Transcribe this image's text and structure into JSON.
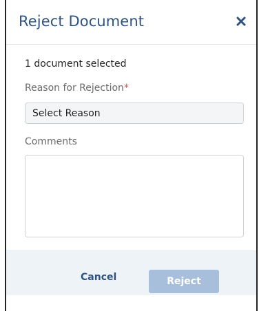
{
  "dialog": {
    "title": "Reject Document",
    "close_icon": "close-icon"
  },
  "body": {
    "selected_count": "1 document selected",
    "reason_label": "Reason for Rejection",
    "required_marker": "*",
    "reason_select_value": "Select Reason",
    "comments_label": "Comments",
    "comments_value": ""
  },
  "footer": {
    "cancel_label": "Cancel",
    "reject_label": "Reject",
    "reject_disabled": true
  },
  "colors": {
    "title": "#2e5381",
    "required": "#d9534f",
    "footer_bg": "#eef3f8",
    "reject_disabled_bg": "#a8bfdb"
  }
}
